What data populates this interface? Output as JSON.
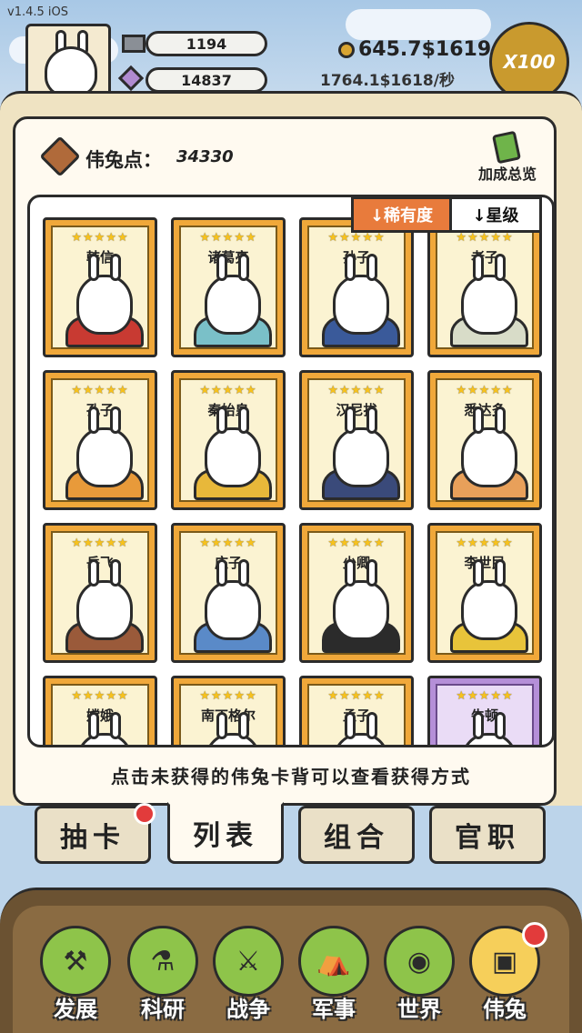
{
  "status": {
    "version": "v1.4.5 iOS"
  },
  "header": {
    "resource_1": "1194",
    "resource_2": "14837",
    "coins": "645.7$1619",
    "coin_rate": "1764.1$1618/秒",
    "multiplier_label": "X100"
  },
  "points": {
    "label": "伟兔点：",
    "value": "34330"
  },
  "bonus": {
    "label": "加成总览",
    "icon": "bonus-list-icon"
  },
  "sort": {
    "rarity_label": "↓稀有度",
    "star_label": "↓星级"
  },
  "cards": [
    {
      "name": "韩信",
      "stars": "★★★★★",
      "robe": "#c83a32"
    },
    {
      "name": "诸葛亮",
      "stars": "★★★★★",
      "robe": "#7ac0c8"
    },
    {
      "name": "孙子",
      "stars": "★★★★★",
      "robe": "#3a5a9a"
    },
    {
      "name": "老子",
      "stars": "★★★★★",
      "robe": "#d8dcc8"
    },
    {
      "name": "孔子",
      "stars": "★★★★★",
      "robe": "#e89a3a"
    },
    {
      "name": "秦始皇",
      "stars": "★★★★★",
      "robe": "#e8b83a"
    },
    {
      "name": "汉尼拔",
      "stars": "★★★★★",
      "robe": "#3a4a7a"
    },
    {
      "name": "悉达多",
      "stars": "★★★★★",
      "robe": "#e8a05a"
    },
    {
      "name": "岳飞",
      "stars": "★★★★★",
      "robe": "#9a5a3a"
    },
    {
      "name": "庄子",
      "stars": "★★★★★",
      "robe": "#5a8ac8"
    },
    {
      "name": "少卿",
      "stars": "★★★★★",
      "robe": "#2b2b2b"
    },
    {
      "name": "李世民",
      "stars": "★★★★★",
      "robe": "#e8c43a"
    },
    {
      "name": "嫦娥",
      "stars": "★★★★★",
      "robe": "#f0f0f0"
    },
    {
      "name": "南丁格尔",
      "stars": "★★★★★",
      "robe": "#c8c8c8"
    },
    {
      "name": "孟子",
      "stars": "★★★★★",
      "robe": "#6aa8d8"
    },
    {
      "name": "牛顿",
      "stars": "★★★★★",
      "robe": "#f0c890"
    }
  ],
  "hint": "点击未获得的伟兔卡背可以查看获得方式",
  "tabs": [
    {
      "label": "抽卡",
      "badge": true
    },
    {
      "label": "列表",
      "active": true
    },
    {
      "label": "组合"
    },
    {
      "label": "官职"
    }
  ],
  "nav": [
    {
      "label": "发展",
      "icon": "axe-icon",
      "glyph": "⚒"
    },
    {
      "label": "科研",
      "icon": "flask-icon",
      "glyph": "⚗"
    },
    {
      "label": "战争",
      "icon": "swords-icon",
      "glyph": "⚔"
    },
    {
      "label": "军事",
      "icon": "tent-icon",
      "glyph": "⛺"
    },
    {
      "label": "世界",
      "icon": "globe-icon",
      "glyph": "◉"
    },
    {
      "label": "伟兔",
      "icon": "card-icon",
      "glyph": "▣",
      "active": true,
      "badge": true
    }
  ],
  "colors": {
    "accent": "#e87b3c",
    "card_gold": "#f0a83a",
    "card_purple": "#b58fd8",
    "nav_green": "#8ec44a"
  }
}
